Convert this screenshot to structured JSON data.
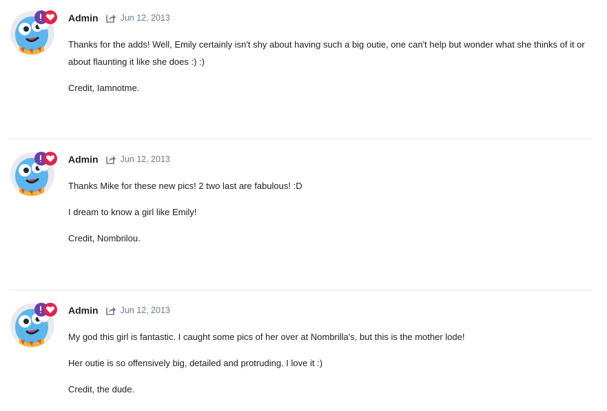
{
  "colors": {
    "accent_purple": "#6b3fa8",
    "heart_red": "#e3224a",
    "date_color": "#6c7a93",
    "divider": "#e6e6e6"
  },
  "icons": {
    "avatar": "blue-bird-cartoon-avatar",
    "badge": "reaction-heart-badge",
    "share": "share-arrow-icon"
  },
  "posts": [
    {
      "author": "Admin",
      "date": "Jun 12, 2013",
      "paragraphs": [
        "Thanks for the adds! Well, Emily certainly isn't shy about having such a big outie, one can't help but wonder what she thinks of it or about flaunting it like she does :)  :)",
        "Credit, Iamnotme."
      ]
    },
    {
      "author": "Admin",
      "date": "Jun 12, 2013",
      "paragraphs": [
        "Thanks Mike for these new pics! 2 two last are fabulous!  :D",
        "I dream to know a girl like Emily!",
        "Credit, Nombrilou."
      ]
    },
    {
      "author": "Admin",
      "date": "Jun 12, 2013",
      "paragraphs": [
        "My god this girl is fantastic.  I caught some pics of her over at Nombrilla's, but this is the mother lode!",
        "Her outie is so offensively big, detailed and protruding.  I love it :)",
        "Credit, the dude."
      ]
    }
  ]
}
